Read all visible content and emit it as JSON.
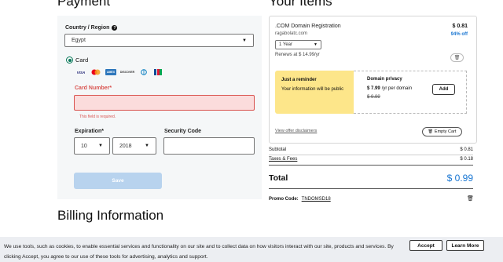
{
  "headings": {
    "payment": "Payment",
    "items": "Your Items",
    "billing": "Billing Information"
  },
  "payment": {
    "country_label": "Country / Region",
    "country_value": "Egypt",
    "card_label": "Card",
    "card_logos": [
      "VISA",
      "Mastercard",
      "AMEX",
      "DISCOVER",
      "Diners Club",
      "JCB"
    ],
    "card_number_label": "Card Number*",
    "card_number_error": "This field is required.",
    "expiration_label": "Expiration*",
    "exp_month": "10",
    "exp_year": "2018",
    "security_code_label": "Security Code",
    "save_label": "Save"
  },
  "items": {
    "name": ".COM Domain Registration",
    "domain": "ragabolatc.com",
    "price": "$ 0.81",
    "discount": "94% off",
    "term": "1 Year",
    "renews": "Renews at $ 14.99/yr",
    "reminder_title": "Just a reminder",
    "reminder_text": "Your information will be public",
    "privacy_title": "Domain privacy",
    "privacy_price": "$ 7.99",
    "privacy_unit": "/yr per domain",
    "privacy_old": "$ 9.99",
    "add_label": "Add",
    "disclaimers": "View offer disclaimers",
    "empty_cart": "Empty Cart"
  },
  "summary": {
    "subtotal_label": "Subtotal",
    "subtotal": "$ 0.81",
    "taxes_label": "Taxes & Fees",
    "taxes": "$ 0.18",
    "total_label": "Total",
    "total": "$ 0.99",
    "promo_label": "Promo Code:",
    "promo_code": "TNDOMSD18"
  },
  "cookie": {
    "text": "We use tools, such as cookies, to enable essential services and functionality on our site and to collect data on how visitors interact with our site, products and services. By clicking Accept, you agree to our use of these tools for advertising, analytics and support.",
    "accept": "Accept",
    "learn_more": "Learn More"
  },
  "colors": {
    "accent": "#0a7a5a",
    "error": "#d9534f",
    "total": "#1976d2",
    "reminder": "#fde68a"
  }
}
